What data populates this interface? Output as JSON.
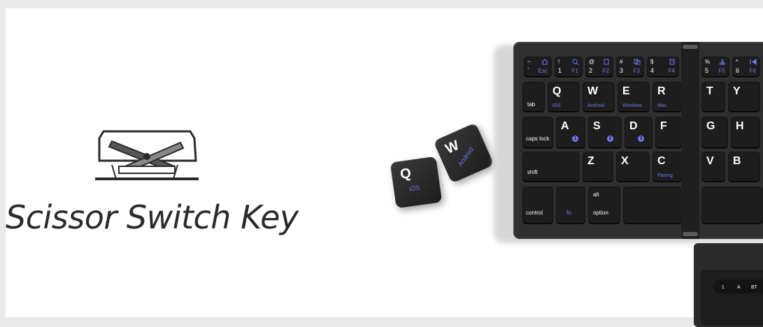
{
  "headline": "Scissor Switch Key",
  "mechanism_icon": "scissor-switch-mechanism-icon",
  "loose_keys": [
    {
      "main": "Q",
      "sub": "iOS"
    },
    {
      "main": "W",
      "sub": "Android"
    }
  ],
  "keyboard": {
    "fn_row": [
      {
        "top": "~",
        "main": "`",
        "fn": "Esc"
      },
      {
        "top": "!",
        "main": "1",
        "fn": "F1"
      },
      {
        "top": "@",
        "main": "2",
        "fn": "F2"
      },
      {
        "top": "#",
        "main": "3",
        "fn": "F3"
      },
      {
        "top": "$",
        "main": "4",
        "fn": "F4"
      },
      {
        "top": "%",
        "main": "5",
        "fn": "F5"
      },
      {
        "top": "^",
        "main": "6",
        "fn": "F6"
      }
    ],
    "tab_row": [
      {
        "label": "tab",
        "sub": ""
      },
      {
        "label": "Q",
        "sub": "iOS"
      },
      {
        "label": "W",
        "sub": "Android"
      },
      {
        "label": "E",
        "sub": "Windows"
      },
      {
        "label": "R",
        "sub": "Mac"
      },
      {
        "label": "T",
        "sub": ""
      },
      {
        "label": "Y",
        "sub": ""
      }
    ],
    "caps_row": [
      {
        "label": "caps lock",
        "badge": ""
      },
      {
        "label": "A",
        "badge": "1"
      },
      {
        "label": "S",
        "badge": "2"
      },
      {
        "label": "D",
        "badge": "3"
      },
      {
        "label": "F",
        "badge": ""
      },
      {
        "label": "G",
        "badge": ""
      },
      {
        "label": "H",
        "badge": ""
      }
    ],
    "shift_row": [
      {
        "label": "shift",
        "sub": ""
      },
      {
        "label": "Z",
        "sub": ""
      },
      {
        "label": "X",
        "sub": ""
      },
      {
        "label": "C",
        "sub": "Pairing"
      },
      {
        "label": "V",
        "sub": ""
      },
      {
        "label": "B",
        "sub": ""
      }
    ],
    "bottom_row": [
      {
        "label": "control",
        "top": ""
      },
      {
        "label": "fn",
        "top": ""
      },
      {
        "label": "option",
        "top": "alt"
      },
      {
        "label": "",
        "top": ""
      },
      {
        "label": "",
        "top": ""
      }
    ]
  },
  "status_pill": [
    "1",
    "A",
    "BT"
  ],
  "colors": {
    "accent": "#6f7cf2",
    "key": "#1d1d1d",
    "body": "#2f2f2f"
  }
}
